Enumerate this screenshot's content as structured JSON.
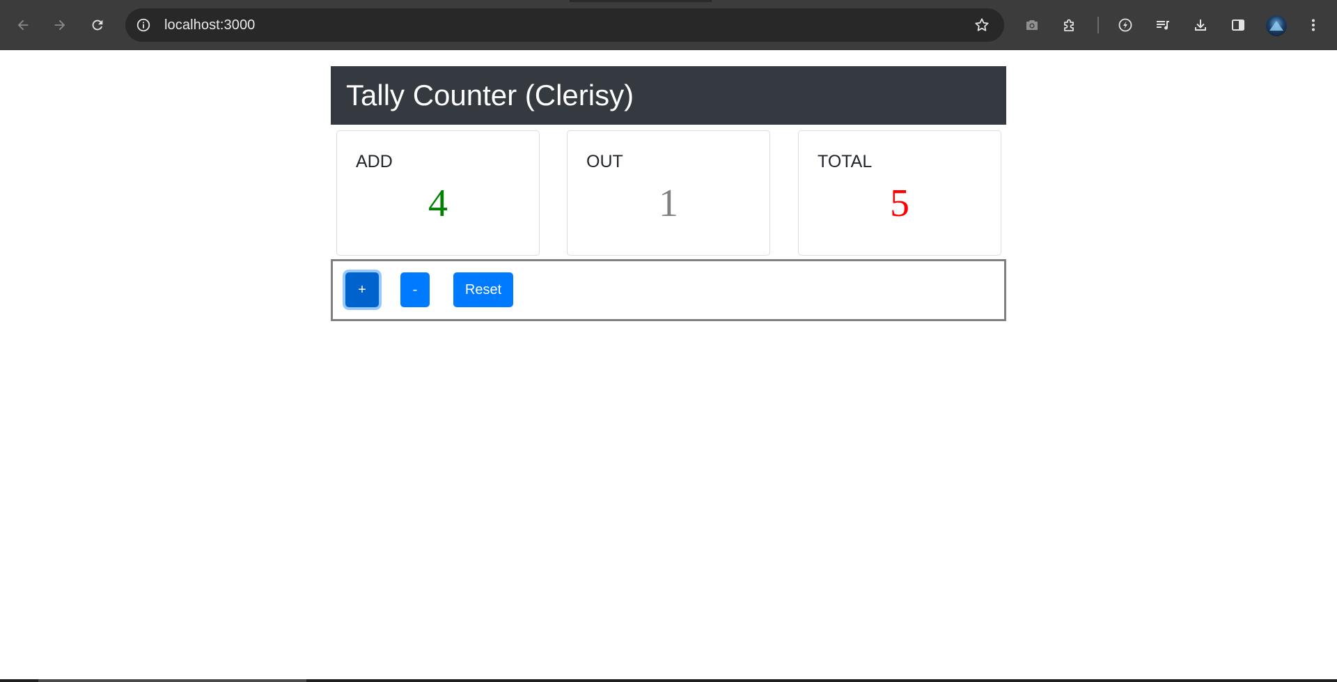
{
  "browser": {
    "url": "localhost:3000",
    "icons": {
      "back": "back-arrow-icon",
      "forward": "forward-arrow-icon",
      "reload": "reload-icon",
      "site_info": "info-icon",
      "bookmark": "star-icon",
      "screenshot": "camera-icon",
      "extensions": "puzzle-icon",
      "performance": "speedometer-icon",
      "media": "media-queue-icon",
      "downloads": "download-icon",
      "side_panel": "side-panel-icon",
      "menu": "kebab-menu-icon"
    },
    "colors": {
      "toolbar": "#3c3c3c",
      "omnibox": "#282828"
    }
  },
  "app": {
    "title": "Tally Counter (Clerisy)",
    "cards": [
      {
        "label": "ADD",
        "value": "4",
        "color": "#008000"
      },
      {
        "label": "OUT",
        "value": "1",
        "color": "#808080"
      },
      {
        "label": "TOTAL",
        "value": "5",
        "color": "#ff0000"
      }
    ],
    "controls": {
      "increment_label": "+",
      "decrement_label": "-",
      "reset_label": "Reset"
    },
    "colors": {
      "header": "#343a40",
      "button": "#007bff"
    }
  }
}
